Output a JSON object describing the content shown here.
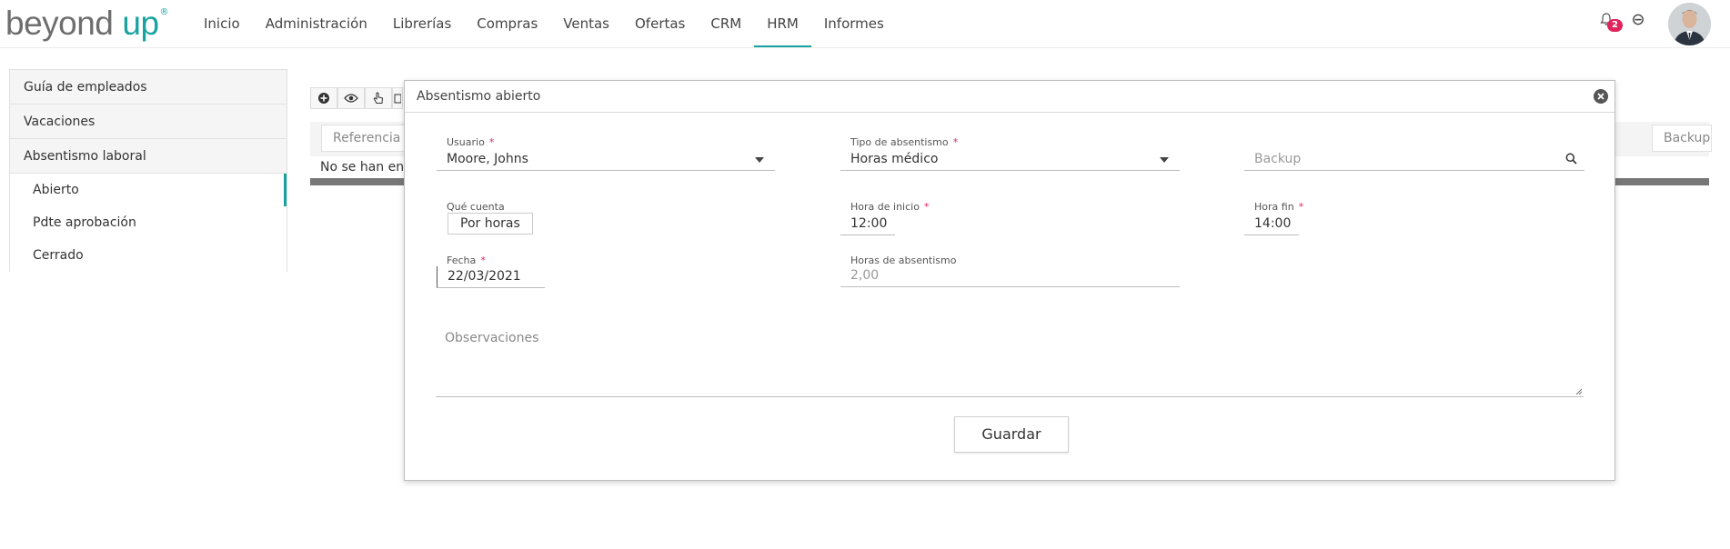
{
  "brand": {
    "part1": "beyond",
    "part2": "up",
    "mark": "®"
  },
  "nav": [
    {
      "label": "Inicio"
    },
    {
      "label": "Administración"
    },
    {
      "label": "Librerías"
    },
    {
      "label": "Compras"
    },
    {
      "label": "Ventas"
    },
    {
      "label": "Ofertas"
    },
    {
      "label": "CRM"
    },
    {
      "label": "HRM",
      "active": true
    },
    {
      "label": "Informes"
    }
  ],
  "notifications": {
    "count": "2"
  },
  "sidebar": {
    "sections": [
      {
        "label": "Guía de empleados"
      },
      {
        "label": "Vacaciones"
      },
      {
        "label": "Absentismo laboral"
      }
    ],
    "subitems": [
      {
        "label": "Abierto",
        "active": true
      },
      {
        "label": "Pdte aprobación"
      },
      {
        "label": "Cerrado"
      }
    ]
  },
  "table": {
    "col_referencia": "Referencia",
    "col_backup": "Backup",
    "no_results": "No se han enco"
  },
  "modal": {
    "title": "Absentismo abierto",
    "usuario": {
      "label": "Usuario",
      "value": "Moore, Johns"
    },
    "tipo": {
      "label": "Tipo de absentismo",
      "value": "Horas médico"
    },
    "backup": {
      "placeholder": "Backup"
    },
    "que_cuenta": {
      "label": "Qué cuenta",
      "value": "Por horas"
    },
    "hora_inicio": {
      "label": "Hora de inicio",
      "value": "12:00"
    },
    "hora_fin": {
      "label": "Hora fin",
      "value": "14:00"
    },
    "fecha": {
      "label": "Fecha",
      "value": "22/03/2021"
    },
    "horas_abs": {
      "label": "Horas de absentismo",
      "value": "2,00"
    },
    "observaciones": {
      "placeholder": "Observaciones"
    },
    "save_label": "Guardar",
    "required_mark": "*"
  },
  "colors": {
    "accent": "#19a3a0",
    "badge": "#e0245e"
  }
}
